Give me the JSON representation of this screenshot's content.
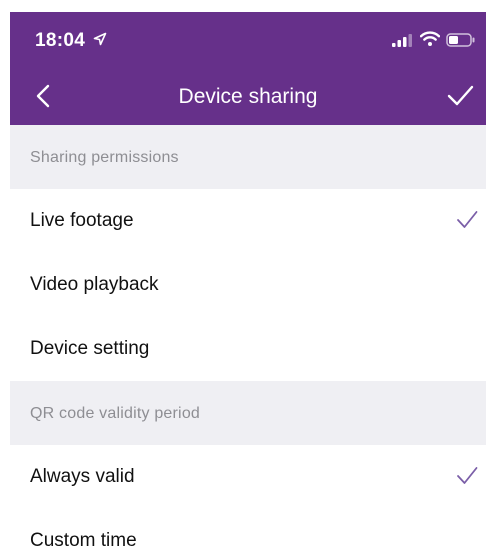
{
  "status_bar": {
    "time": "18:04"
  },
  "nav": {
    "title": "Device sharing",
    "back_icon": "chevron-left-icon",
    "confirm_icon": "checkmark-icon"
  },
  "colors": {
    "brand": "#66308a",
    "check": "#7b5fa8",
    "section_bg": "#efeff3",
    "section_text": "#8e8e93"
  },
  "sections": [
    {
      "title": "Sharing permissions",
      "items": [
        {
          "label": "Live footage",
          "checked": true
        },
        {
          "label": "Video playback",
          "checked": false
        },
        {
          "label": "Device setting",
          "checked": false
        }
      ]
    },
    {
      "title": "QR code validity period",
      "items": [
        {
          "label": "Always valid",
          "checked": true
        },
        {
          "label": "Custom time",
          "checked": false
        }
      ]
    }
  ]
}
